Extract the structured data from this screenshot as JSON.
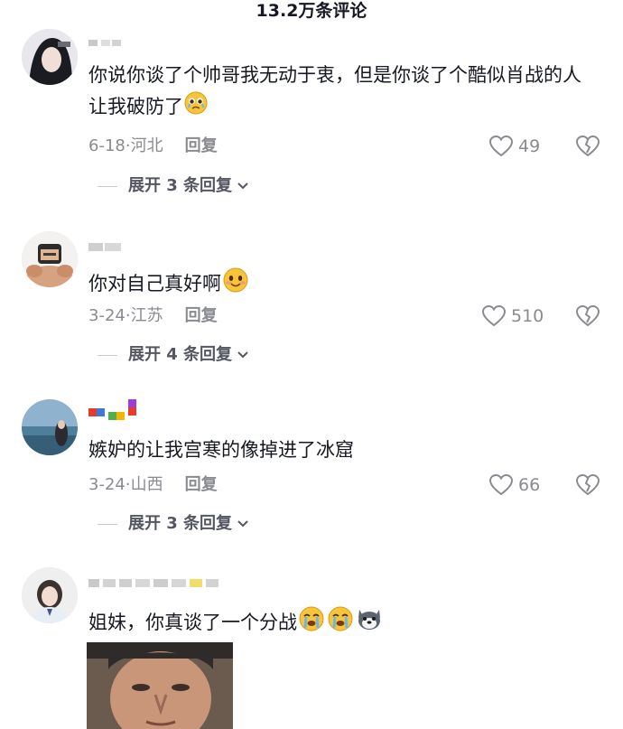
{
  "header": {
    "title": "13.2万条评论"
  },
  "comments": [
    {
      "text": "你说你谈了个帅哥我无动于衷，但是你谈了个酷似肖战的人让我破防了",
      "date": "6-18",
      "location": "河北",
      "reply_label": "回复",
      "likes": "49",
      "expand_label": "展开 3 条回复"
    },
    {
      "text": "你对自己真好啊",
      "date": "3-24",
      "location": "江苏",
      "reply_label": "回复",
      "likes": "510",
      "expand_label": "展开 4 条回复"
    },
    {
      "text": "嫉妒的让我宫寒的像掉进了冰窟",
      "date": "3-24",
      "location": "山西",
      "reply_label": "回复",
      "likes": "66",
      "expand_label": "展开 3 条回复"
    },
    {
      "text": "姐妹，你真谈了一个分战"
    }
  ],
  "colors": {
    "meta": "#8a8b91",
    "text": "#161823",
    "expand": "#545661"
  }
}
